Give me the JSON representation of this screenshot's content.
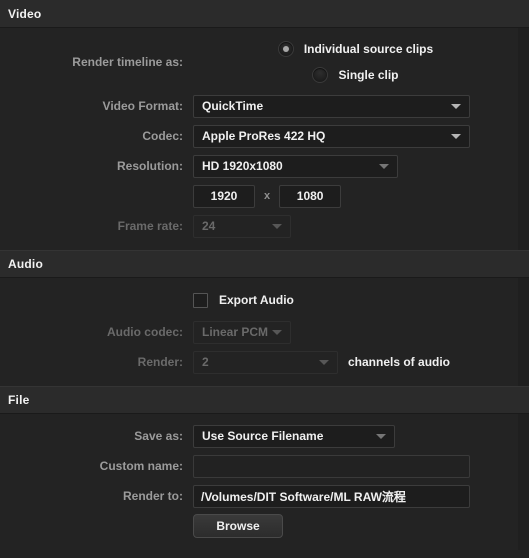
{
  "sections": {
    "video": {
      "title": "Video",
      "render_timeline_label": "Render timeline as:",
      "radio_individual": "Individual source clips",
      "radio_single": "Single clip",
      "video_format_label": "Video Format:",
      "video_format_value": "QuickTime",
      "codec_label": "Codec:",
      "codec_value": "Apple ProRes 422 HQ",
      "resolution_label": "Resolution:",
      "resolution_value": "HD 1920x1080",
      "width_value": "1920",
      "x_separator": "x",
      "height_value": "1080",
      "frame_rate_label": "Frame rate:",
      "frame_rate_value": "24"
    },
    "audio": {
      "title": "Audio",
      "export_audio_label": "Export Audio",
      "export_audio_checked": false,
      "audio_codec_label": "Audio codec:",
      "audio_codec_value": "Linear PCM",
      "render_label": "Render:",
      "render_channels_value": "2",
      "channels_suffix": "channels of audio"
    },
    "file": {
      "title": "File",
      "save_as_label": "Save as:",
      "save_as_value": "Use Source Filename",
      "custom_name_label": "Custom name:",
      "custom_name_value": "",
      "render_to_label": "Render to:",
      "render_to_value": "/Volumes/DIT Software/ML RAW流程",
      "browse_label": "Browse"
    }
  },
  "icons": {
    "dropdown": "chevron-down-icon",
    "radio_selected": "radio-selected-icon",
    "radio_unselected": "radio-unselected-icon",
    "checkbox_unchecked": "checkbox-unchecked-icon"
  },
  "colors": {
    "background": "#232323",
    "header_bar": "#2b2b2b",
    "label_text": "#9b9b9b",
    "value_text": "#f0f0f0",
    "disabled_text": "#6a6a6a",
    "field_background": "#1d1d1d",
    "field_border": "#3c3c3c"
  }
}
